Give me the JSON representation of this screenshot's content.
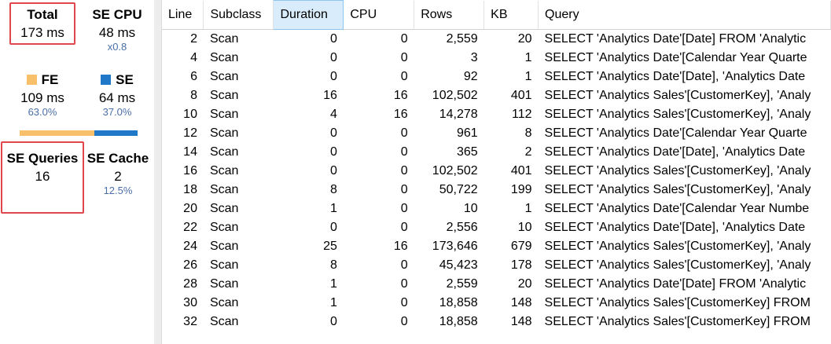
{
  "metrics": {
    "total": {
      "label": "Total",
      "value": "173 ms"
    },
    "se_cpu": {
      "label": "SE CPU",
      "value": "48 ms",
      "sub": "x0.8"
    },
    "fe": {
      "label": "FE",
      "value": "109 ms",
      "sub": "63.0%",
      "color": "#f8c06a",
      "fraction": 0.63
    },
    "se": {
      "label": "SE",
      "value": "64 ms",
      "sub": "37.0%",
      "color": "#1f78c8"
    },
    "se_queries": {
      "label": "SE Queries",
      "value": "16"
    },
    "se_cache": {
      "label": "SE Cache",
      "value": "2",
      "sub": "12.5%"
    }
  },
  "table": {
    "active_column": "Duration",
    "headers": [
      "Line",
      "Subclass",
      "Duration",
      "CPU",
      "Rows",
      "KB",
      "Query"
    ],
    "rows": [
      [
        "2",
        "Scan",
        "0",
        "0",
        "2,559",
        "20",
        "SELECT 'Analytics Date'[Date] FROM 'Analytic"
      ],
      [
        "4",
        "Scan",
        "0",
        "0",
        "3",
        "1",
        "SELECT 'Analytics Date'[Calendar Year Quarte"
      ],
      [
        "6",
        "Scan",
        "0",
        "0",
        "92",
        "1",
        "SELECT 'Analytics Date'[Date], 'Analytics Date"
      ],
      [
        "8",
        "Scan",
        "16",
        "16",
        "102,502",
        "401",
        "SELECT 'Analytics Sales'[CustomerKey], 'Analy"
      ],
      [
        "10",
        "Scan",
        "4",
        "16",
        "14,278",
        "112",
        "SELECT 'Analytics Sales'[CustomerKey], 'Analy"
      ],
      [
        "12",
        "Scan",
        "0",
        "0",
        "961",
        "8",
        "SELECT 'Analytics Date'[Calendar Year Quarte"
      ],
      [
        "14",
        "Scan",
        "0",
        "0",
        "365",
        "2",
        "SELECT 'Analytics Date'[Date], 'Analytics Date"
      ],
      [
        "16",
        "Scan",
        "0",
        "0",
        "102,502",
        "401",
        "SELECT 'Analytics Sales'[CustomerKey], 'Analy"
      ],
      [
        "18",
        "Scan",
        "8",
        "0",
        "50,722",
        "199",
        "SELECT 'Analytics Sales'[CustomerKey], 'Analy"
      ],
      [
        "20",
        "Scan",
        "1",
        "0",
        "10",
        "1",
        "SELECT 'Analytics Date'[Calendar Year Numbe"
      ],
      [
        "22",
        "Scan",
        "0",
        "0",
        "2,556",
        "10",
        "SELECT 'Analytics Date'[Date], 'Analytics Date"
      ],
      [
        "24",
        "Scan",
        "25",
        "16",
        "173,646",
        "679",
        "SELECT 'Analytics Sales'[CustomerKey], 'Analy"
      ],
      [
        "26",
        "Scan",
        "8",
        "0",
        "45,423",
        "178",
        "SELECT 'Analytics Sales'[CustomerKey], 'Analy"
      ],
      [
        "28",
        "Scan",
        "1",
        "0",
        "2,559",
        "20",
        "SELECT 'Analytics Date'[Date] FROM 'Analytic"
      ],
      [
        "30",
        "Scan",
        "1",
        "0",
        "18,858",
        "148",
        "SELECT 'Analytics Sales'[CustomerKey] FROM"
      ],
      [
        "32",
        "Scan",
        "0",
        "0",
        "18,858",
        "148",
        "SELECT 'Analytics Sales'[CustomerKey] FROM"
      ]
    ]
  }
}
